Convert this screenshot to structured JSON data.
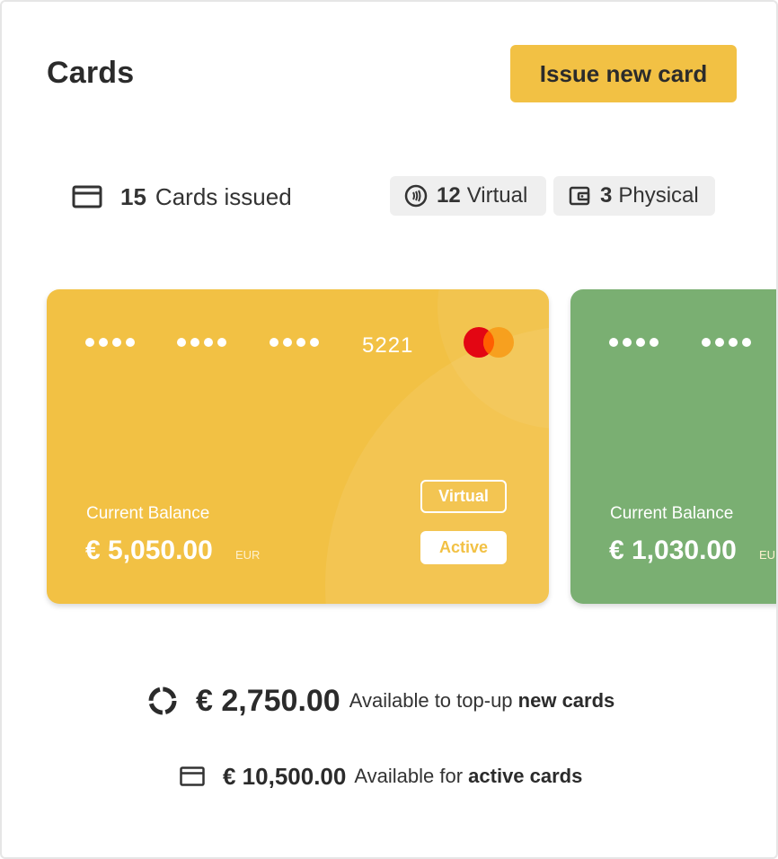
{
  "header": {
    "title": "Cards",
    "issue_button": "Issue new card"
  },
  "stats": {
    "issued_count": "15",
    "issued_label": "Cards issued",
    "virtual_count": "12",
    "virtual_label": "Virtual",
    "physical_count": "3",
    "physical_label": "Physical"
  },
  "cards": [
    {
      "masked": "●●●● ●●●● ●●●●",
      "last4": "5221",
      "brand_icon": "mastercard-logo",
      "balance_label": "Current Balance",
      "balance": "€ 5,050.00",
      "currency": "EUR",
      "type_tag": "Virtual",
      "status_tag": "Active",
      "color": "#f2c144"
    },
    {
      "balance_label": "Current Balance",
      "balance": "€ 1,030.00",
      "currency": "EUR",
      "color": "#7aaf72"
    }
  ],
  "summary": {
    "topup_amount": "€ 2,750.00",
    "topup_text": "Available to top-up",
    "topup_bold": "new cards",
    "active_amount": "€ 10,500.00",
    "active_text": "Available for",
    "active_bold": "active cards"
  },
  "colors": {
    "accent": "#f2c144",
    "green_card": "#7aaf72",
    "pill_bg": "#efefef"
  }
}
